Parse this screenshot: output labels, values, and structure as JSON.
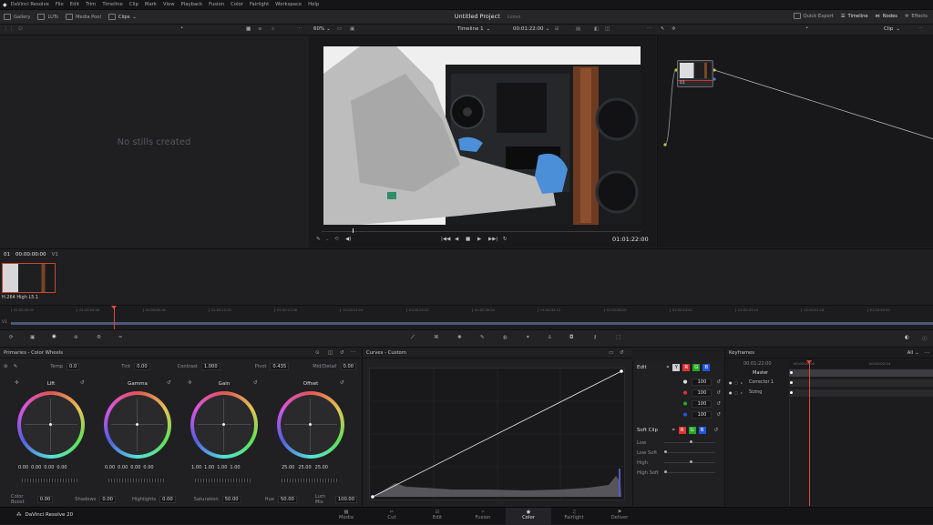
{
  "menubar": {
    "app_name": "DaVinci Resolve",
    "items": [
      "File",
      "Edit",
      "Trim",
      "Timeline",
      "Clip",
      "Mark",
      "View",
      "Playback",
      "Fusion",
      "Color",
      "Fairlight",
      "Workspace",
      "Help"
    ]
  },
  "toolbar": {
    "gallery": "Gallery",
    "luts": "LUTs",
    "media_pool": "Media Pool",
    "clips": "Clips",
    "project_title": "Untitled Project",
    "project_status": "Edited",
    "quick_export": "Quick Export",
    "timeline": "Timeline",
    "nodes": "Nodes",
    "effects": "Effects"
  },
  "subbar": {
    "zoom": "60%",
    "timeline_name": "Timeline 1",
    "timecode": "00:01:22:00",
    "clip_mode": "Clip"
  },
  "gallery": {
    "empty_text": "No stills created"
  },
  "viewer": {
    "timecode": "01:01:22:00"
  },
  "nodes": {
    "node_label": "01"
  },
  "clipstrip": {
    "clip_number": "01",
    "clip_timecode": "00:00:00:00",
    "track": "V1",
    "codec": "H.264 High L5.1"
  },
  "timeline": {
    "track": "V1",
    "ticks": [
      "01:00:00:00",
      "01:00:04:08",
      "01:00:08:16",
      "01:00:12:24",
      "01:00:17:06",
      "01:00:21:14",
      "01:00:25:22",
      "01:00:30:04",
      "01:00:34:12",
      "01:00:38:20",
      "01:00:43:02",
      "01:00:47:10",
      "01:00:51:18",
      "01:00:56:00"
    ]
  },
  "wheels": {
    "title": "Primaries - Color Wheels",
    "top": [
      {
        "label": "Temp",
        "value": "0.0"
      },
      {
        "label": "Tint",
        "value": "0.00"
      },
      {
        "label": "Contrast",
        "value": "1.000"
      },
      {
        "label": "Pivot",
        "value": "0.435"
      },
      {
        "label": "Mid/Detail",
        "value": "0.00"
      }
    ],
    "wheels": [
      {
        "name": "Lift",
        "values": [
          "0.00",
          "0.00",
          "0.00",
          "0.00"
        ]
      },
      {
        "name": "Gamma",
        "values": [
          "0.00",
          "0.00",
          "0.00",
          "0.00"
        ]
      },
      {
        "name": "Gain",
        "values": [
          "1.00",
          "1.00",
          "1.00",
          "1.00"
        ]
      },
      {
        "name": "Offset",
        "values": [
          "25.00",
          "25.00",
          "25.00"
        ]
      }
    ],
    "bottom": [
      {
        "label": "Color Boost",
        "value": "0.00"
      },
      {
        "label": "Shadows",
        "value": "0.00"
      },
      {
        "label": "Highlights",
        "value": "0.00"
      },
      {
        "label": "Saturation",
        "value": "50.00"
      },
      {
        "label": "Hue",
        "value": "50.00"
      },
      {
        "label": "Lum Mix",
        "value": "100.00"
      }
    ]
  },
  "curves": {
    "title": "Curves - Custom"
  },
  "edit": {
    "title": "Edit",
    "channels": [
      "Y",
      "R",
      "G",
      "B"
    ],
    "values": [
      "100",
      "100",
      "100",
      "100"
    ],
    "soft_clip": "Soft Clip",
    "soft_rows": [
      "Low",
      "Low Soft",
      "High",
      "High Soft"
    ]
  },
  "keyframes": {
    "title": "Keyframes",
    "filter": "All",
    "timecode": "00:01:22:00",
    "ruler_left": "00:00:00:00",
    "ruler_right": "00:00:02:24",
    "rows": [
      "Master",
      "Corrector 1",
      "Sizing"
    ]
  },
  "pages": {
    "brand": "DaVinci Resolve 20",
    "items": [
      "Media",
      "Cut",
      "Edit",
      "Fusion",
      "Color",
      "Fairlight",
      "Deliver"
    ],
    "active": "Color"
  }
}
